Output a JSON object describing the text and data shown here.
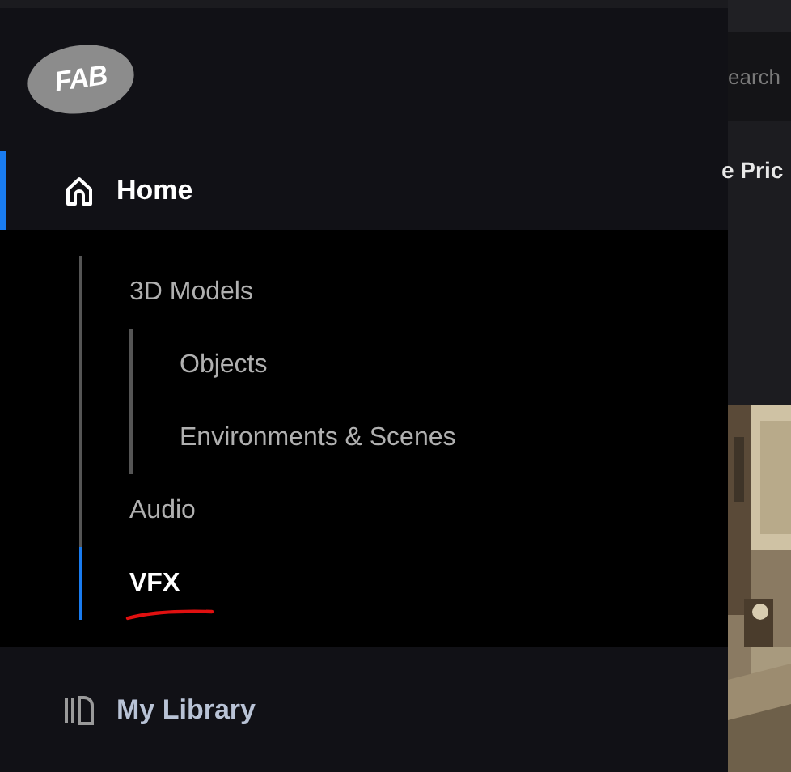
{
  "logo": {
    "text": "FAB"
  },
  "nav": [
    {
      "label": "Home",
      "selected": true,
      "expanded": true,
      "children": [
        {
          "label": "3D Models",
          "selected": false,
          "expanded": true,
          "children": [
            {
              "label": "Objects",
              "selected": false
            },
            {
              "label": "Environments & Scenes",
              "selected": false
            }
          ]
        },
        {
          "label": "Audio",
          "selected": false
        },
        {
          "label": "VFX",
          "selected": true,
          "underlined": true
        }
      ]
    },
    {
      "label": "My Library",
      "selected": false
    }
  ],
  "search": {
    "placeholder": "earch"
  },
  "filter": {
    "label": "e Pric"
  }
}
